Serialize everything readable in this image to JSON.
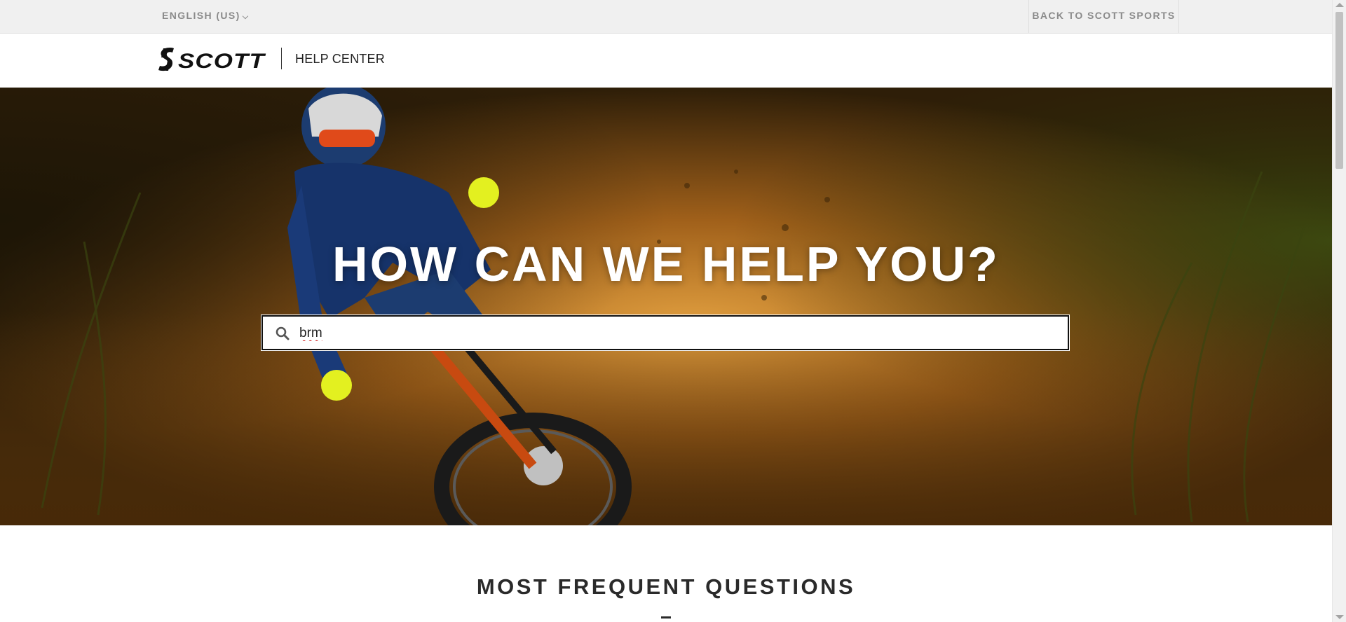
{
  "topbar": {
    "language_label": "ENGLISH (US)",
    "back_link": "BACK TO SCOTT SPORTS"
  },
  "header": {
    "brand": "SCOTT",
    "section": "HELP CENTER"
  },
  "hero": {
    "title": "HOW CAN WE HELP YOU?",
    "search": {
      "value": "brm",
      "icon": "search-icon"
    }
  },
  "faq": {
    "title": "MOST FREQUENT QUESTIONS"
  },
  "colors": {
    "topbar_bg": "#f0f0f0",
    "text_muted": "#8a8a8a",
    "hero_title": "#ffffff",
    "heading_dark": "#2a2a2a"
  }
}
